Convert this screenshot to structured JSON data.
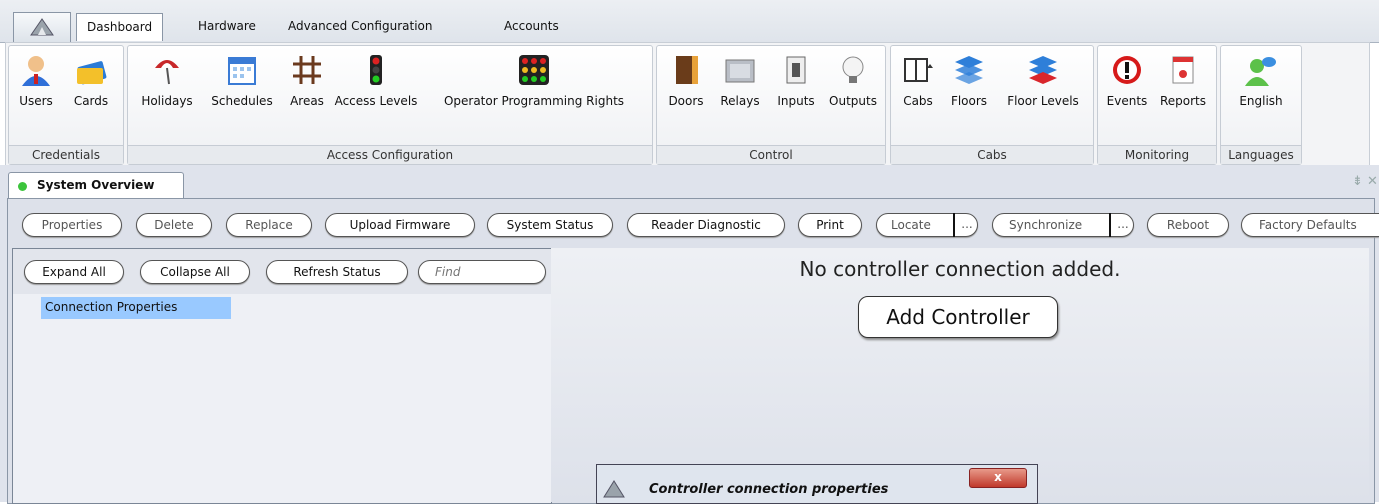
{
  "top_tabs": [
    {
      "label": "Dashboard",
      "active": true
    },
    {
      "label": "Hardware",
      "active": false
    },
    {
      "label": "Advanced Configuration",
      "active": false
    },
    {
      "label": "Accounts",
      "active": false
    }
  ],
  "ribbon": {
    "groups": {
      "credentials": {
        "caption": "Credentials",
        "items": [
          "Users",
          "Cards"
        ]
      },
      "access": {
        "caption": "Access Configuration",
        "items": [
          "Holidays",
          "Schedules",
          "Areas",
          "Access Levels",
          "Operator Programming Rights"
        ]
      },
      "control": {
        "caption": "Control",
        "items": [
          "Doors",
          "Relays",
          "Inputs",
          "Outputs"
        ]
      },
      "cabs": {
        "caption": "Cabs",
        "items": [
          "Cabs",
          "Floors",
          "Floor Levels"
        ]
      },
      "monitoring": {
        "caption": "Monitoring",
        "items": [
          "Events",
          "Reports"
        ]
      },
      "languages": {
        "caption": "Languages",
        "items": [
          "English"
        ]
      }
    }
  },
  "doc_tab": {
    "label": "System Overview",
    "status_color": "#3cc43c"
  },
  "toolbar": [
    "Properties",
    "Delete",
    "Replace",
    "Upload Firmware",
    "System Status",
    "Reader Diagnostic",
    "Print",
    "Locate",
    "Synchronize",
    "Reboot",
    "Factory Defaults"
  ],
  "toolbar_more": "...",
  "left_toolbar": {
    "expand": "Expand All",
    "collapse": "Collapse All",
    "refresh": "Refresh Status",
    "find_placeholder": "Find"
  },
  "tree": {
    "items": [
      "Connection Properties"
    ]
  },
  "main": {
    "message": "No controller connection added.",
    "add_button": "Add Controller"
  },
  "dialog": {
    "title": "Controller connection properties",
    "close": "x"
  },
  "colors": {
    "accent_selected": "#99c9ff",
    "ribbon_bg": "#f3f4f6",
    "panel_bg": "#dde1ea"
  }
}
